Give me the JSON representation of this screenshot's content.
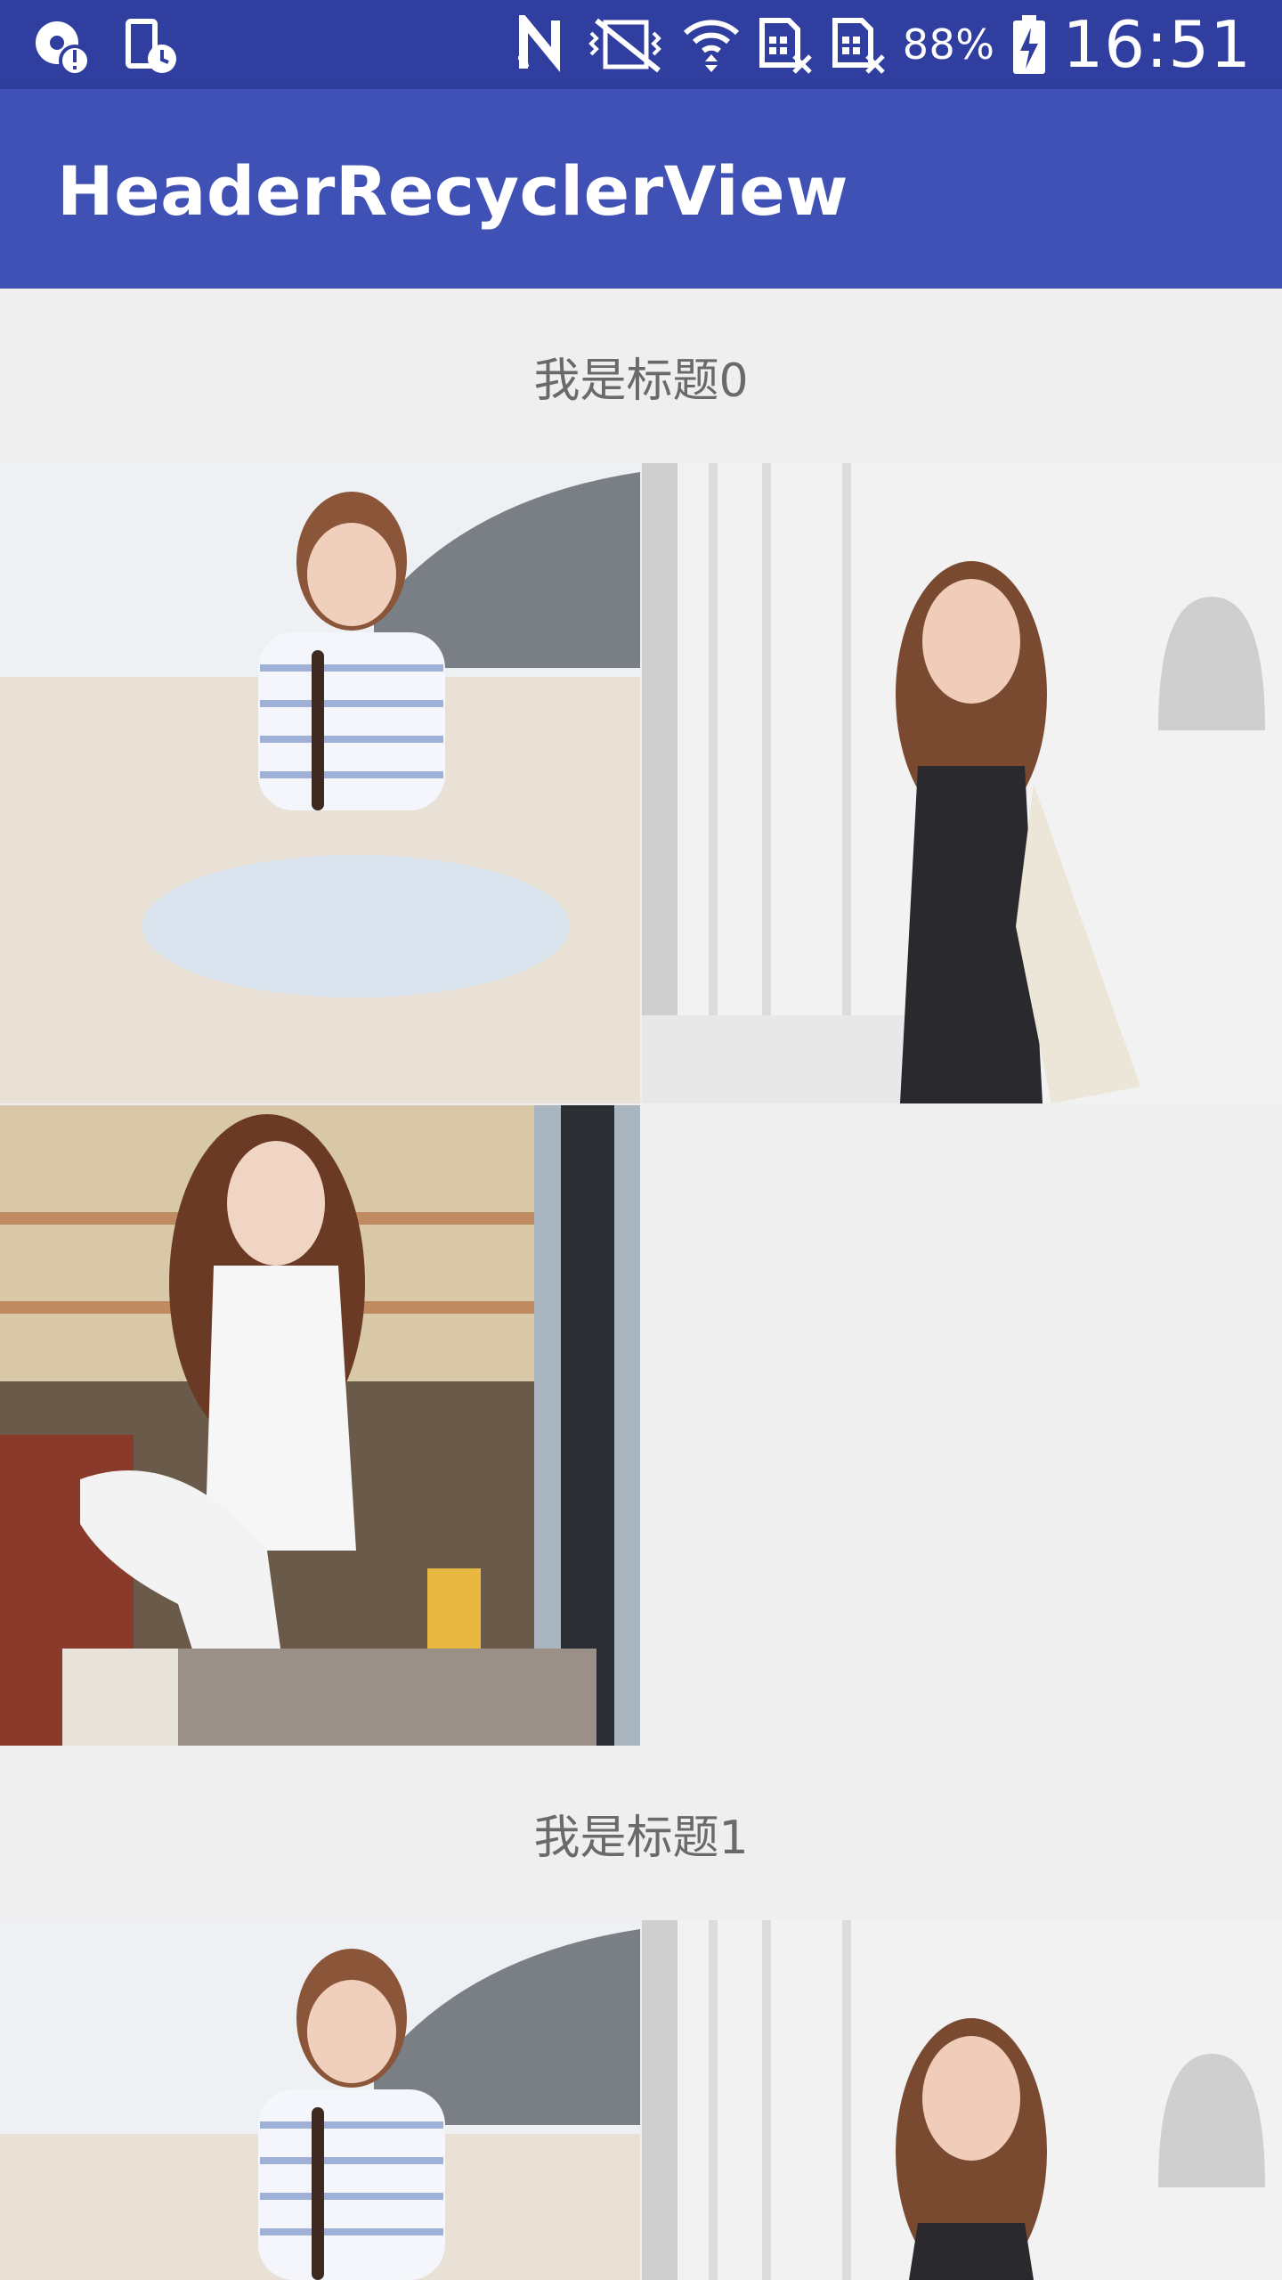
{
  "status_bar": {
    "battery_percent": "88%",
    "time": "16:51",
    "icons": [
      "alert-icon",
      "device-clock-icon",
      "nfc-icon",
      "vibrate-icon",
      "wifi-icon",
      "sim-no-signal-icon",
      "sim-no-signal-icon",
      "battery-charging-icon"
    ]
  },
  "app_bar": {
    "title": "HeaderRecyclerView"
  },
  "sections": [
    {
      "title": "我是标题0"
    },
    {
      "title": "我是标题1"
    }
  ]
}
